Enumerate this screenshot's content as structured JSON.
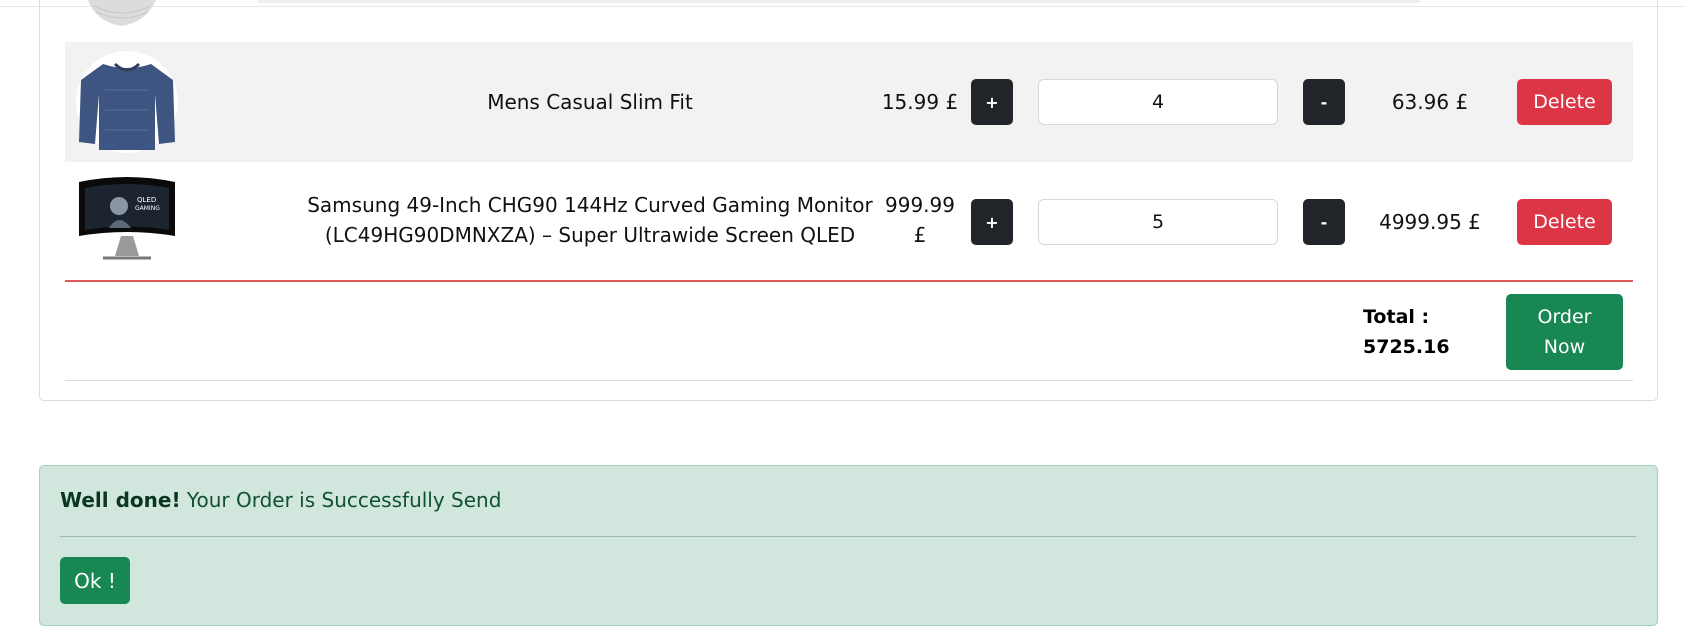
{
  "cart": {
    "items": [
      {
        "name": "Mens Casual Slim Fit",
        "price": "15.99 £",
        "quantity": "4",
        "subtotal": "63.96 £",
        "image": "blue-shirt"
      },
      {
        "name_line1": "Samsung 49-Inch CHG90 144Hz Curved Gaming Monitor",
        "name_line2": "(LC49HG90DMNXZA) – Super Ultrawide Screen QLED",
        "price_line1": "999.99",
        "price_line2": "£",
        "quantity": "5",
        "subtotal": "4999.95 £",
        "image": "curved-monitor"
      }
    ],
    "plus_label": "+",
    "minus_label": "-",
    "delete_label": "Delete",
    "total_label": "Total :",
    "total_value": "5725.16",
    "order_label_line1": "Order",
    "order_label_line2": "Now"
  },
  "alert": {
    "strong": "Well done!",
    "message": " Your Order is Successfully Send",
    "ok_label": "Ok !"
  },
  "colors": {
    "danger": "#dc3545",
    "success": "#198754",
    "dark": "#212529",
    "alert_bg": "#d1e7dd"
  }
}
